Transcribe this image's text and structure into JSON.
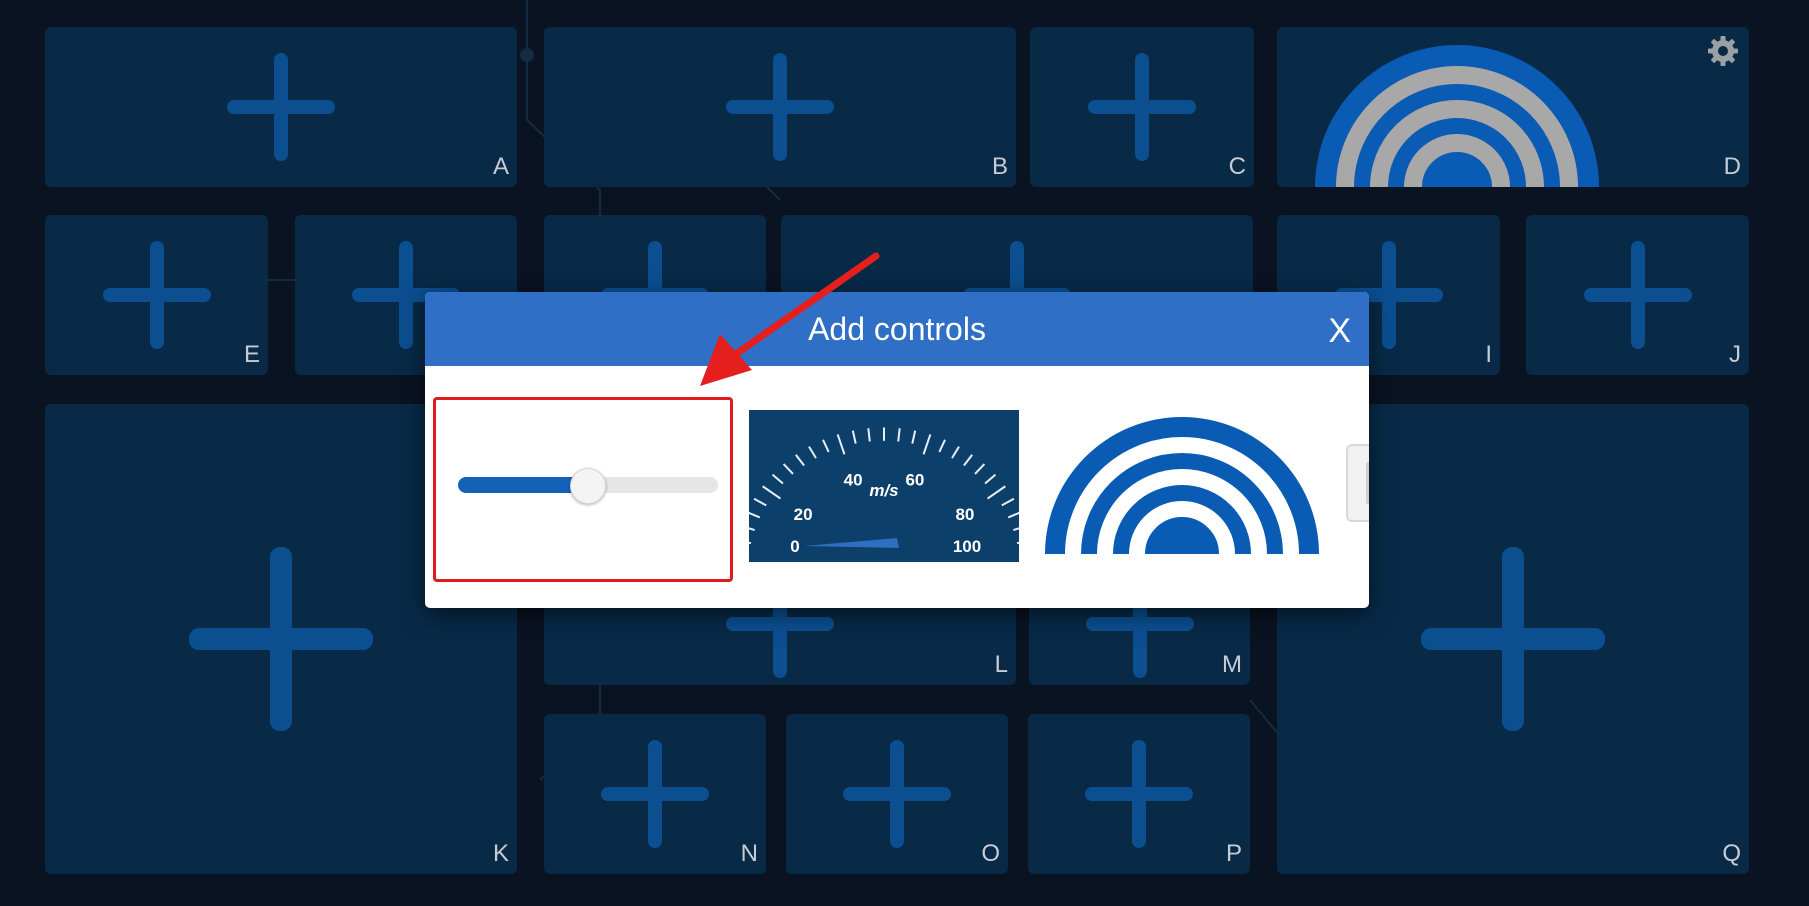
{
  "tiles": [
    {
      "letter": "A"
    },
    {
      "letter": "B"
    },
    {
      "letter": "C"
    },
    {
      "letter": "D"
    },
    {
      "letter": "E"
    },
    {
      "letter": "I"
    },
    {
      "letter": "J"
    },
    {
      "letter": "K"
    },
    {
      "letter": "L"
    },
    {
      "letter": "M"
    },
    {
      "letter": "N"
    },
    {
      "letter": "O"
    },
    {
      "letter": "P"
    },
    {
      "letter": "Q"
    }
  ],
  "dialog": {
    "title": "Add controls",
    "close_label": "X",
    "slider_value": 0.5,
    "gauge": {
      "unit": "m/s",
      "ticks": [
        "0",
        "20",
        "40",
        "60",
        "80",
        "100"
      ],
      "value": 0
    }
  },
  "colors": {
    "background": "#0a1322",
    "tile": "#082a47",
    "plus": "#0b4f91",
    "dialog_header": "#2f6fc5",
    "highlight": "#e01b1b",
    "accent": "#1462b8"
  },
  "icons": [
    "plus-icon",
    "gear-icon",
    "wifi-signal-icon",
    "close-icon"
  ]
}
